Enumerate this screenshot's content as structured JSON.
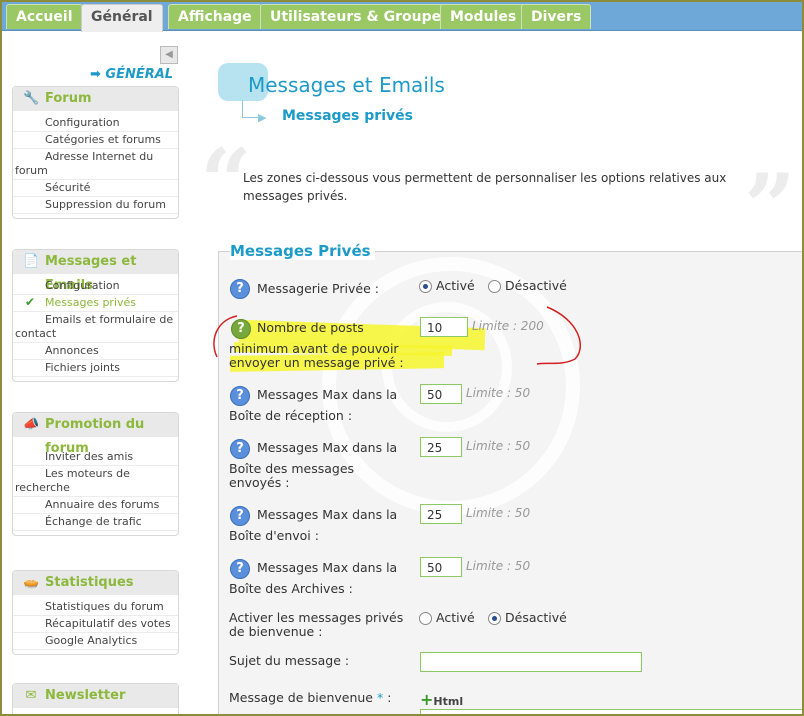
{
  "tabs": [
    {
      "label": "Accueil"
    },
    {
      "label": "Général"
    },
    {
      "label": "Affichage"
    },
    {
      "label": "Utilisateurs & Groupes"
    },
    {
      "label": "Modules"
    },
    {
      "label": "Divers"
    }
  ],
  "sidebar": {
    "collapse_symbol": "◀",
    "general_title": "➡ GÉNÉRAL",
    "sections": [
      {
        "title": "Forum",
        "icon": "wrench-icon",
        "items": [
          "Configuration",
          "Catégories et forums",
          "Adresse Internet du forum",
          "Sécurité",
          "Suppression du forum"
        ]
      },
      {
        "title": "Messages et Emails",
        "icon": "document-icon",
        "items": [
          "Configuration",
          "Messages privés",
          "Emails et formulaire de contact",
          "Annonces",
          "Fichiers joints"
        ]
      },
      {
        "title": "Promotion du forum",
        "icon": "megaphone-icon",
        "items": [
          "Inviter des amis",
          "Les moteurs de recherche",
          "Annuaire des forums",
          "Échange de trafic"
        ]
      },
      {
        "title": "Statistiques",
        "icon": "pie-chart-icon",
        "items": [
          "Statistiques du forum",
          "Récapitulatif des votes",
          "Google Analytics"
        ]
      },
      {
        "title": "Newsletter",
        "icon": "envelope-icon",
        "items": []
      }
    ]
  },
  "main": {
    "title": "Messages et Emails",
    "subtitle": "Messages privés",
    "intro": "Les zones ci-dessous vous permettent de personnaliser les options relatives aux messages privés.",
    "section_title": "Messages Privés",
    "fields": {
      "pm_label": "Messagerie Privée :",
      "opt_active": "Activé",
      "opt_inactive": "Désactivé",
      "min_posts_label_1": "Nombre de posts",
      "min_posts_label_2": "minimum avant de pouvoir",
      "min_posts_label_3": "envoyer un message privé :",
      "min_posts_value": "10",
      "min_posts_limit": "Limite : 200",
      "max_inbox_label_1": "Messages Max dans la",
      "max_inbox_label_2": "Boîte de réception :",
      "max_inbox_value": "50",
      "limit_50": "Limite : 50",
      "max_sent_label_1": "Messages Max dans la",
      "max_sent_label_2": "Boîte des messages",
      "max_sent_label_3": "envoyés :",
      "max_sent_value": "25",
      "max_outbox_label_1": "Messages Max dans la",
      "max_outbox_label_2": "Boîte d'envoi :",
      "max_outbox_value": "25",
      "max_archive_label_1": "Messages Max dans la",
      "max_archive_label_2": "Boîte des Archives :",
      "max_archive_value": "50",
      "welcome_label_1": "Activer les messages privés",
      "welcome_label_2": "de bienvenue :",
      "subject_label": "Sujet du message :",
      "subject_value": "",
      "welcome_msg_label": "Message de bienvenue",
      "required_mark": "*",
      "colon": ":",
      "html_button": "Html"
    }
  },
  "colors": {
    "accent_blue": "#1c9ac8",
    "accent_green": "#8cb83c",
    "tab_bar": "#6ea8d8",
    "highlight": "#f6f42a",
    "annotation_red": "#d42020"
  }
}
